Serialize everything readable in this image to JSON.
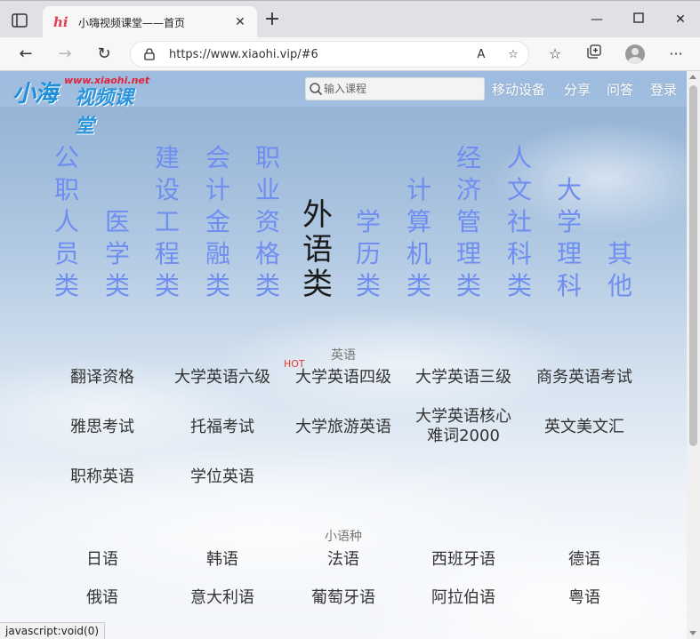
{
  "browser": {
    "tab_title": "小嗨视频课堂——首页",
    "favicon_text": "hi",
    "url": "https://www.xiaohi.vip/#6",
    "read_aloud_icon_text": "A",
    "status_text": "javascript:void(0)"
  },
  "site": {
    "logo_main": "小海",
    "logo_url": "www.xiaohi.net",
    "logo_sub": "视频课堂",
    "search_placeholder": "输入课程",
    "nav": [
      "移动设备",
      "分享",
      "问答",
      "登录"
    ]
  },
  "categories": [
    {
      "label": "公职人员类",
      "active": false
    },
    {
      "label": "医学类",
      "active": false
    },
    {
      "label": "建设工程类",
      "active": false
    },
    {
      "label": "会计金融类",
      "active": false
    },
    {
      "label": "职业资格类",
      "active": false
    },
    {
      "label": "外语类",
      "active": true
    },
    {
      "label": "学历类",
      "active": false
    },
    {
      "label": "计算机类",
      "active": false
    },
    {
      "label": "经济管理类",
      "active": false
    },
    {
      "label": "人文社科类",
      "active": false
    },
    {
      "label": "大学理科",
      "active": false
    },
    {
      "label": "其他",
      "active": false
    }
  ],
  "sections": [
    {
      "title": "英语",
      "hot_label": "HOT",
      "items": [
        "翻译资格",
        "大学英语六级",
        "大学英语四级",
        "大学英语三级",
        "商务英语考试",
        "雅思考试",
        "托福考试",
        "大学旅游英语",
        "大学英语核心难词2000",
        "英文美文汇",
        "职称英语",
        "学位英语"
      ]
    },
    {
      "title": "小语种",
      "items": [
        "日语",
        "韩语",
        "法语",
        "西班牙语",
        "德语",
        "俄语",
        "意大利语",
        "葡萄牙语",
        "阿拉伯语",
        "粤语"
      ]
    }
  ],
  "colors": {
    "category_inactive": "#6f8ef0",
    "category_active": "#1a1a1a",
    "hot": "#e53935"
  }
}
